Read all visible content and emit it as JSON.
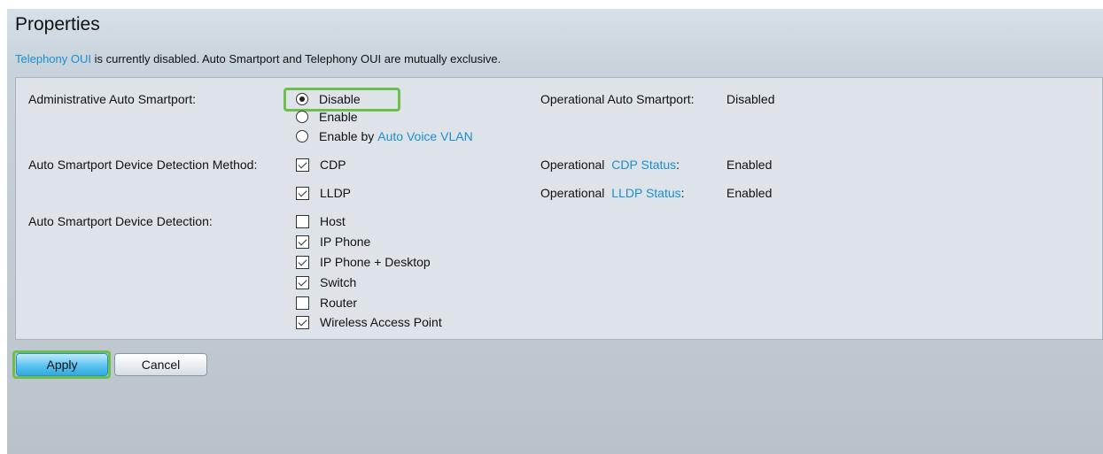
{
  "header": {
    "title": "Properties",
    "notice_link": "Telephony OUI",
    "notice_text": " is currently disabled. Auto Smartport and Telephony OUI are mutually exclusive."
  },
  "admin": {
    "label": "Administrative Auto Smartport:",
    "options": [
      {
        "label": "Disable",
        "selected": true
      },
      {
        "label": "Enable",
        "selected": false
      },
      {
        "label_prefix": "Enable by ",
        "label_link": "Auto Voice VLAN",
        "selected": false
      }
    ],
    "operational_label": "Operational Auto Smartport:",
    "operational_value": "Disabled"
  },
  "detection_method": {
    "label": "Auto Smartport Device Detection Method:",
    "cdp": {
      "label": "CDP",
      "checked": true
    },
    "lldp": {
      "label": "LLDP",
      "checked": true
    },
    "cdp_status_prefix": "Operational ",
    "cdp_status_link": "CDP Status",
    "cdp_status_suffix": ":",
    "cdp_status_value": "Enabled",
    "lldp_status_prefix": "Operational ",
    "lldp_status_link": "LLDP Status",
    "lldp_status_suffix": ":",
    "lldp_status_value": "Enabled"
  },
  "detection": {
    "label": "Auto Smartport Device Detection:",
    "devices": [
      {
        "label": "Host",
        "checked": false
      },
      {
        "label": "IP Phone",
        "checked": true
      },
      {
        "label": "IP Phone + Desktop",
        "checked": true
      },
      {
        "label": "Switch",
        "checked": true
      },
      {
        "label": "Router",
        "checked": false
      },
      {
        "label": "Wireless Access Point",
        "checked": true
      }
    ]
  },
  "buttons": {
    "apply": "Apply",
    "cancel": "Cancel"
  },
  "colors": {
    "link": "#1a8fd0",
    "highlight": "#6cc04a",
    "apply_button": "#5cc3f0"
  }
}
